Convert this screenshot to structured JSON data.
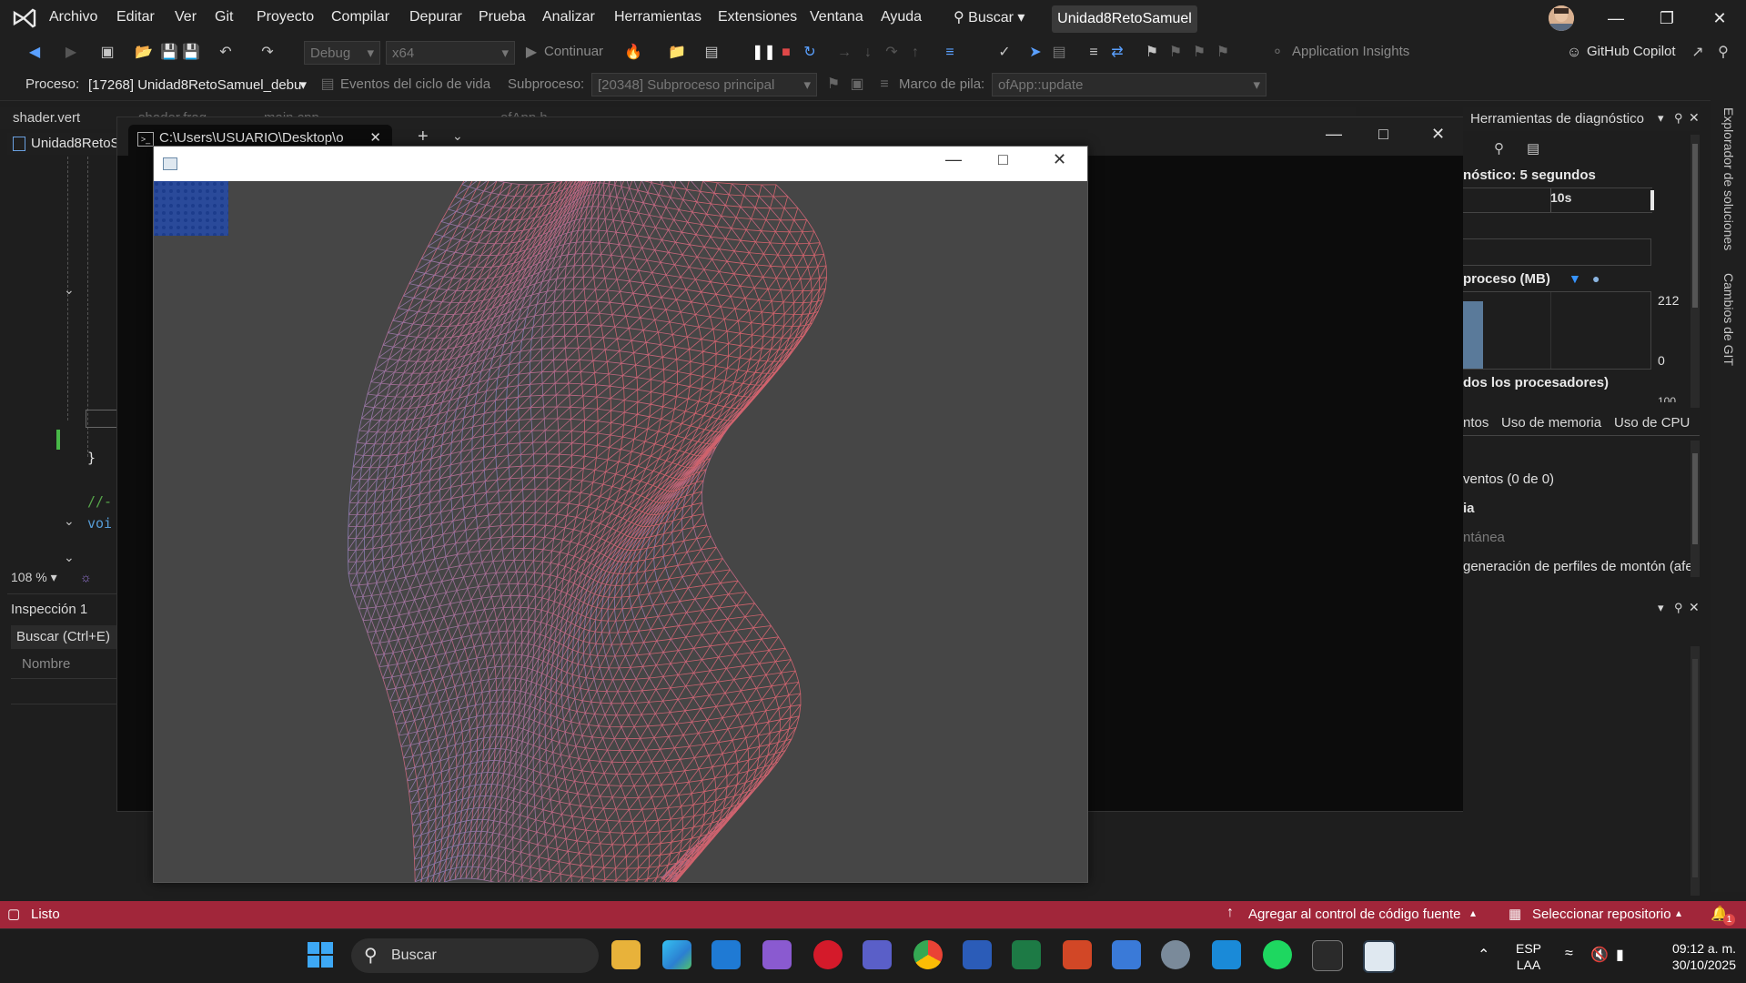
{
  "menubar": {
    "items": [
      "Archivo",
      "Editar",
      "Ver",
      "Git",
      "Proyecto",
      "Compilar",
      "Depurar",
      "Prueba",
      "Analizar",
      "Herramientas",
      "Extensiones",
      "Ventana",
      "Ayuda"
    ],
    "search_label": "Buscar",
    "solution_title": "Unidad8RetoSamuel"
  },
  "toolbar": {
    "config": "Debug",
    "platform": "x64",
    "continue_label": "Continuar",
    "app_insights": "Application Insights",
    "copilot": "GitHub Copilot"
  },
  "debug_toolbar": {
    "process_label": "Proceso:",
    "process_value": "[17268] Unidad8RetoSamuel_debu",
    "lifecycle_label": "Eventos del ciclo de vida",
    "thread_label": "Subproceso:",
    "thread_value": "[20348] Subproceso principal",
    "stack_label": "Marco de pila:",
    "stack_value": "ofApp::update"
  },
  "editor": {
    "tabs": [
      "shader.vert",
      "shader.frag",
      "main.cpp",
      "ofApp.h"
    ],
    "doc_tab": "Unidad8RetoS",
    "code_brace": "}",
    "code_comment": "//-",
    "code_keyword": "voi",
    "zoom": "108 %"
  },
  "inspection": {
    "title": "Inspección 1",
    "search_placeholder": "Buscar (Ctrl+E)",
    "column_name": "Nombre"
  },
  "console": {
    "tab_title": "C:\\Users\\USUARIO\\Desktop\\o"
  },
  "diagnostics": {
    "title": "Herramientas de diagnóstico",
    "session_label": "nóstico: 5 segundos",
    "timeline_tick": "10s",
    "memory_label": "proceso (MB)",
    "memory_max": "212",
    "memory_min": "0",
    "cpu_label": "dos los procesadores)",
    "cpu_max": "100",
    "tabs": [
      "ntos",
      "Uso de memoria",
      "Uso de CPU"
    ],
    "events": "ventos (0 de 0)",
    "row_ia": "ia",
    "snapshot": "ntánea",
    "heap_profiling": "generación de perfiles de montón (afec"
  },
  "right_rail": {
    "solution_explorer": "Explorador de soluciones",
    "git_changes": "Cambios de GIT"
  },
  "statusbar": {
    "ready": "Listo",
    "add_source_control": "Agregar al control de código fuente",
    "select_repo": "Seleccionar repositorio",
    "notif_count": "1"
  },
  "taskbar": {
    "search_placeholder": "Buscar",
    "lang_top": "ESP",
    "lang_bottom": "LAA",
    "time": "09:12 a. m.",
    "date": "30/10/2025"
  },
  "colors": {
    "mesh_red": "#d9646e",
    "mesh_blue": "#6f86c8",
    "status_bar": "#a1263a",
    "accent": "#3794ff"
  }
}
